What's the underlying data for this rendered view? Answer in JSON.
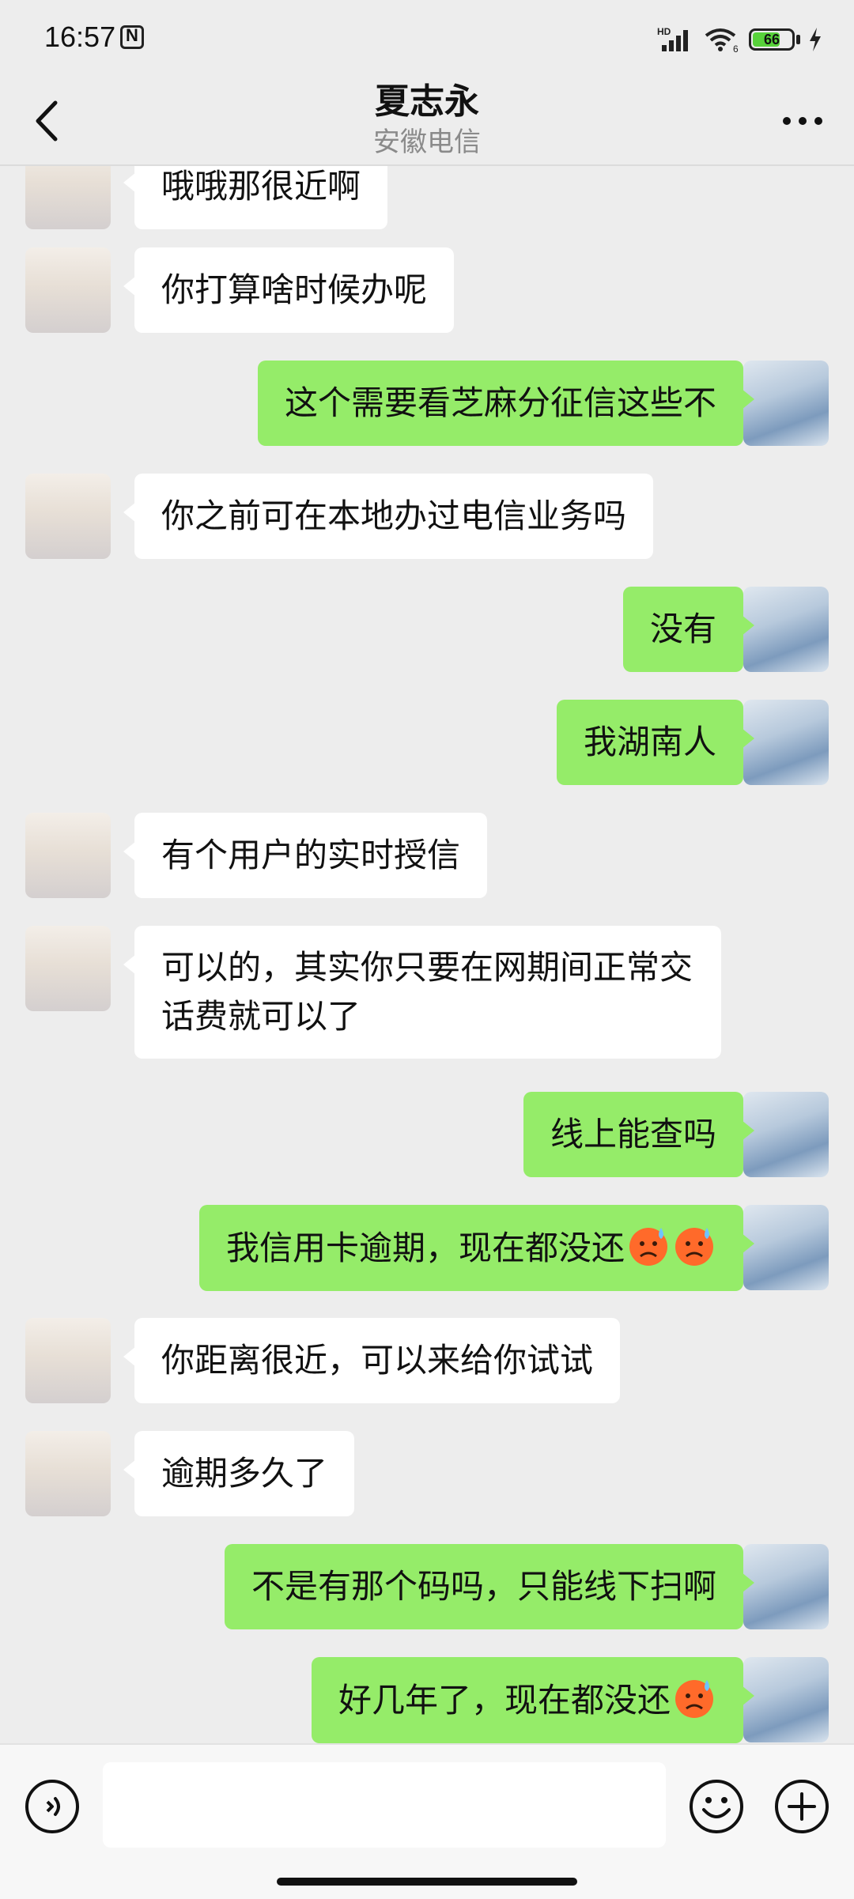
{
  "status_bar": {
    "time": "16:57",
    "battery": "66",
    "network_label": "HD",
    "wifi_label": "6"
  },
  "header": {
    "title": "夏志永",
    "subtitle": "安徽电信"
  },
  "messages": [
    {
      "side": "left",
      "text": "哦哦那很近啊"
    },
    {
      "side": "left",
      "text": "你打算啥时候办呢"
    },
    {
      "side": "right",
      "text": "这个需要看芝麻分征信这些不"
    },
    {
      "side": "left",
      "text": "你之前可在本地办过电信业务吗"
    },
    {
      "side": "right",
      "text": "没有"
    },
    {
      "side": "right",
      "text": "我湖南人"
    },
    {
      "side": "left",
      "text": "有个用户的实时授信"
    },
    {
      "side": "left",
      "text": "可以的，其实你只要在网期间正常交话费就可以了"
    },
    {
      "side": "right",
      "text": "线上能查吗"
    },
    {
      "side": "right",
      "text": "我信用卡逾期，现在都没还",
      "emoji": "cold-sweat-emoji x2"
    },
    {
      "side": "left",
      "text": "你距离很近，可以来给你试试"
    },
    {
      "side": "left",
      "text": "逾期多久了"
    },
    {
      "side": "right",
      "text": "不是有那个码吗，只能线下扫啊"
    },
    {
      "side": "right",
      "text": "好几年了，现在都没还",
      "emoji": "cold-sweat-emoji"
    }
  ],
  "icons": {
    "back": "chevron-left-icon",
    "more": "more-dots-icon",
    "voice": "voice-icon",
    "emoji": "emoji-icon",
    "plus": "plus-icon"
  },
  "colors": {
    "outgoing_bubble": "#95ec69",
    "incoming_bubble": "#ffffff",
    "background": "#ededed",
    "subtitle": "#8a8a8a"
  }
}
